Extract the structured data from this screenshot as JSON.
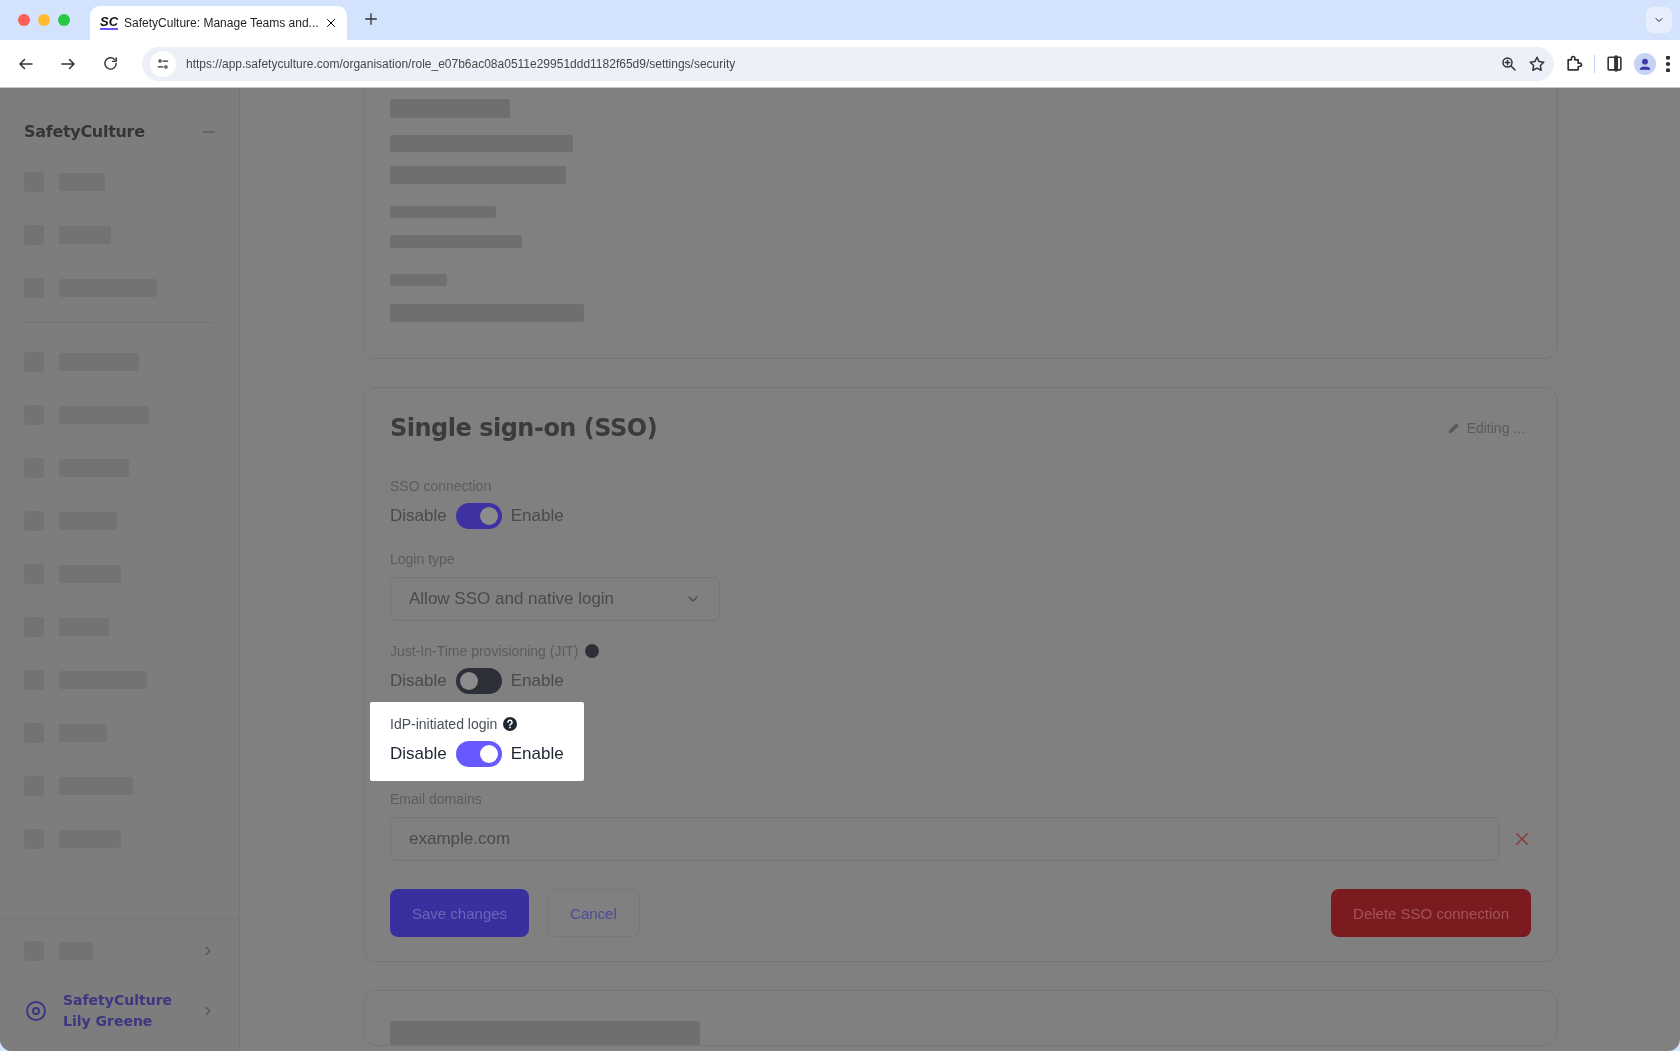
{
  "browser": {
    "tab_logo": "SC",
    "tab_title": "SafetyCulture: Manage Teams and...",
    "url": "https://app.safetyculture.com/organisation/role_e07b6ac08a0511e29951ddd1182f65d9/settings/security"
  },
  "sidebar": {
    "brand": "SafetyCulture",
    "account": {
      "org": "SafetyCulture",
      "user": "Lily Greene"
    }
  },
  "sso_card": {
    "title": "Single sign-on (SSO)",
    "status": "Editing ...",
    "fields": [
      {
        "kind": "toggle",
        "label": "SSO connection",
        "off_label": "Disable",
        "on_label": "Enable",
        "on": true,
        "info": false,
        "highlighted": false
      },
      {
        "kind": "select",
        "label": "Login type",
        "value": "Allow SSO and native login"
      },
      {
        "kind": "toggle",
        "label": "Just-In-Time provisioning (JIT)",
        "off_label": "Disable",
        "on_label": "Enable",
        "on": false,
        "info": true,
        "highlighted": false
      },
      {
        "kind": "toggle",
        "label": "IdP-initiated login",
        "off_label": "Disable",
        "on_label": "Enable",
        "on": true,
        "info": true,
        "highlighted": true
      },
      {
        "kind": "input",
        "label": "Email domains",
        "value": "example.com"
      }
    ],
    "buttons": [
      {
        "label": "Save changes",
        "kind": "primary"
      },
      {
        "label": "Cancel",
        "kind": "secondary"
      },
      {
        "label": "Delete SSO connection",
        "kind": "danger"
      }
    ]
  }
}
